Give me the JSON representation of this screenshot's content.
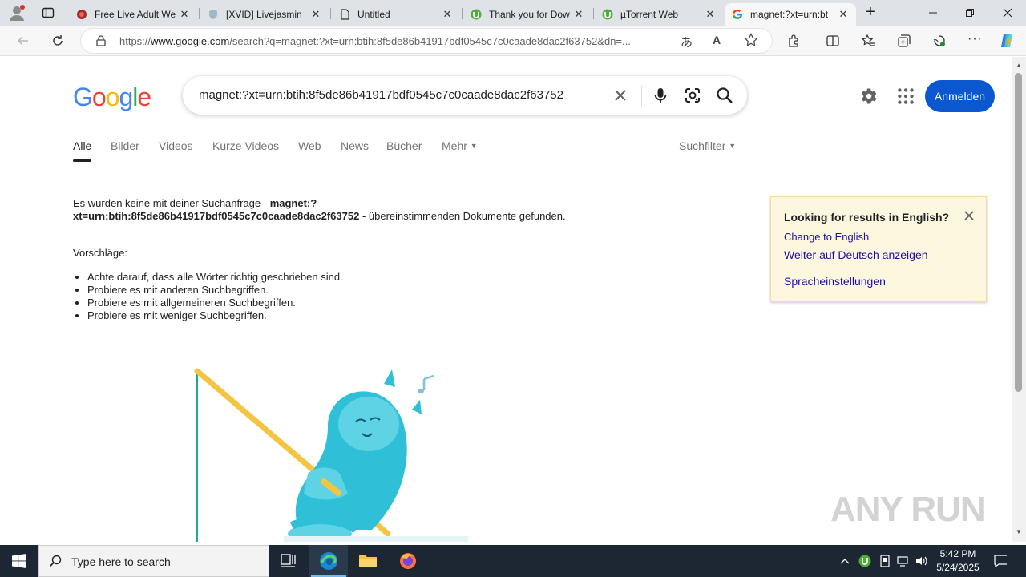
{
  "browser": {
    "tabs": [
      {
        "title": "Free Live Adult We",
        "favicon": "red-circle-icon"
      },
      {
        "title": "[XVID] Livejasmin",
        "favicon": "shield-icon"
      },
      {
        "title": "Untitled",
        "favicon": "page-icon"
      },
      {
        "title": "Thank you for Dow",
        "favicon": "utorrent-icon"
      },
      {
        "title": "µTorrent Web",
        "favicon": "utorrent-icon"
      },
      {
        "title": "magnet:?xt=urn:bt",
        "favicon": "google-icon"
      }
    ],
    "url_prefix": "https://",
    "url_domain": "www.google.com",
    "url_rest": "/search?q=magnet:?xt=urn:btih:8f5de86b41917bdf0545c7c0caade8dac2f63752&dn=..."
  },
  "google": {
    "logo": [
      "G",
      "o",
      "o",
      "g",
      "l",
      "e"
    ],
    "query": "magnet:?xt=urn:btih:8f5de86b41917bdf0545c7c0caade8dac2f63752",
    "signin_label": "Anmelden",
    "tabs": [
      "Alle",
      "Bilder",
      "Videos",
      "Kurze Videos",
      "Web",
      "News",
      "Bücher",
      "Mehr"
    ],
    "filter_label": "Suchfilter",
    "noresult_pre": "Es wurden keine mit deiner Suchanfrage - ",
    "noresult_query": "magnet:?xt=urn:btih:8f5de86b41917bdf0545c7c0caade8dac2f63752",
    "noresult_post": " - übereinstimmenden Dokumente gefunden.",
    "suggestions_title": "Vorschläge:",
    "suggestions": [
      "Achte darauf, dass alle Wörter richtig geschrieben sind.",
      "Probiere es mit anderen Suchbegriffen.",
      "Probiere es mit allgemeineren Suchbegriffen.",
      "Probiere es mit weniger Suchbegriffen."
    ],
    "lang_box": {
      "title": "Looking for results in English?",
      "change": "Change to English",
      "stay": "Weiter auf Deutsch anzeigen",
      "settings": "Spracheinstellungen"
    }
  },
  "watermark": "ANY RUN",
  "taskbar": {
    "search_placeholder": "Type here to search",
    "time": "5:42 PM",
    "date": "5/24/2025"
  },
  "colors": {
    "google_blue": "#4285F4",
    "google_red": "#EA4335",
    "google_yellow": "#FBBC05",
    "google_green": "#34A853",
    "signin": "#0b57d0",
    "link": "#1a0dab"
  }
}
